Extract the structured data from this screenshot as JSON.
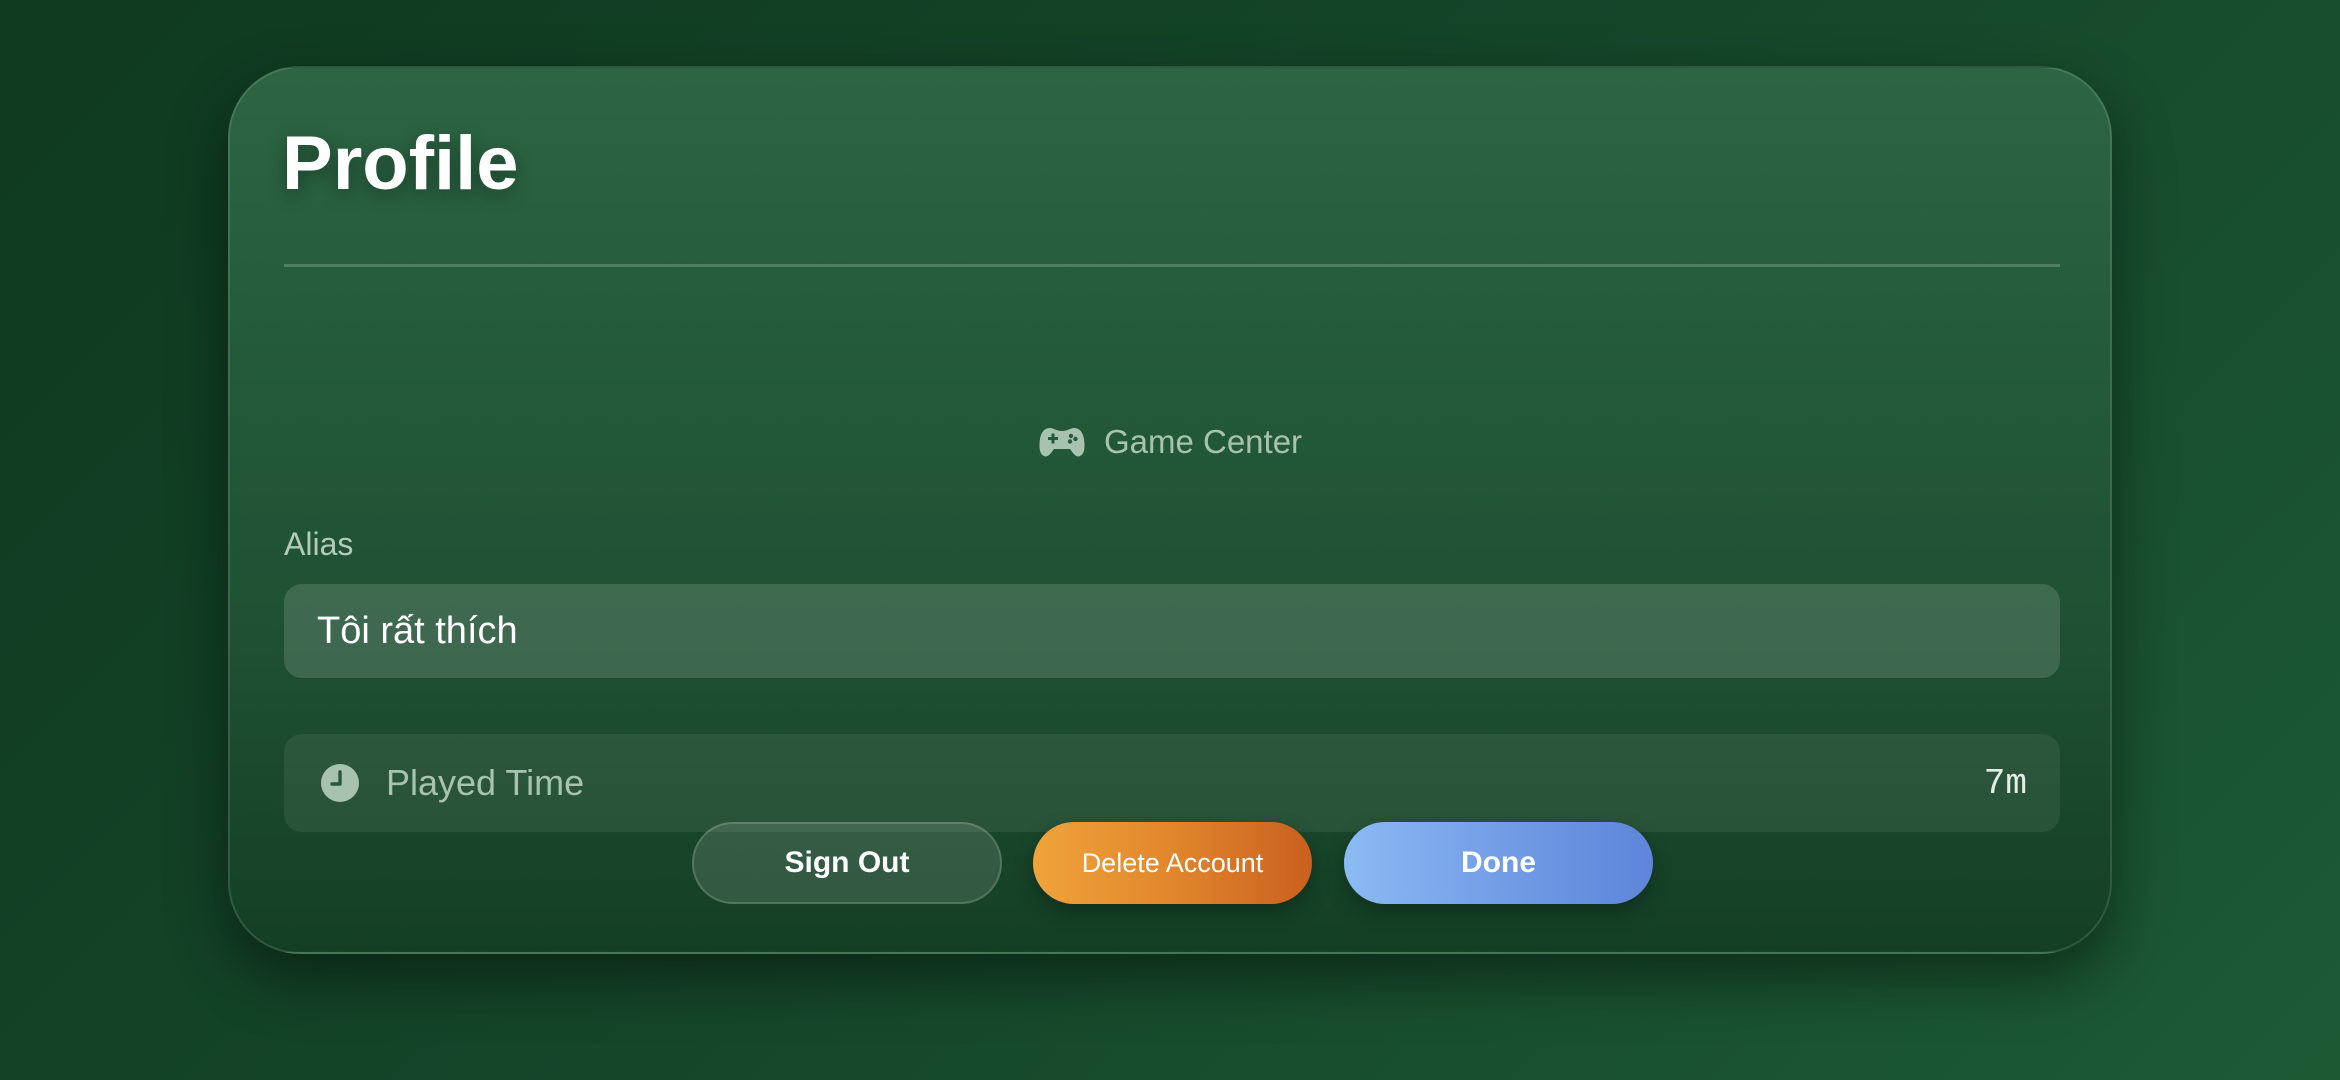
{
  "profile": {
    "title": "Profile"
  },
  "game_center": {
    "label": "Game Center",
    "icon": "gamecontroller-icon"
  },
  "alias": {
    "label": "Alias",
    "value": "Tôi rất thích"
  },
  "played_time": {
    "icon": "clock-icon",
    "label": "Played Time",
    "value": "7m"
  },
  "buttons": {
    "sign_out": "Sign Out",
    "delete_account": "Delete Account",
    "done": "Done"
  },
  "colors": {
    "background": "#15462a",
    "card": "#245b3b",
    "delete_accent": "#e1862c",
    "done_accent": "#729ee6"
  }
}
